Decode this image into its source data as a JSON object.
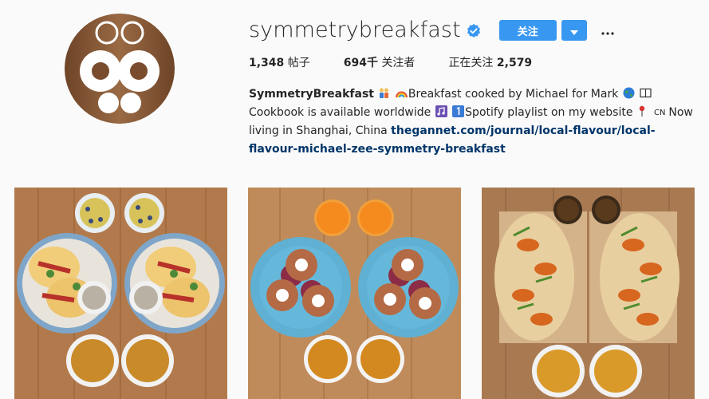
{
  "profile": {
    "username": "symmetrybreakfast",
    "follow_label": "关注",
    "posts_count": "1,348",
    "posts_label": "帖子",
    "followers_count": "694千",
    "followers_label": "关注者",
    "following_label": "正在关注",
    "following_count": "2,579",
    "bio": {
      "full_name": "SymmetryBreakfast",
      "seg1": "Breakfast cooked by Michael for Mark",
      "seg2": "Cookbook is available worldwide",
      "seg3": "Spotify playlist on my website",
      "seg4": "Now living in Shanghai, China",
      "link": "thegannet.com/journal/local-flavour/local-flavour-michael-zee-symmetry-breakfast"
    }
  },
  "icons": {
    "verified": "verified-badge-icon",
    "dropdown": "chevron-down-icon",
    "more": "more-options-icon"
  },
  "colors": {
    "accent": "#3897f0",
    "link": "#003569",
    "background": "#fafafa"
  },
  "posts": [
    {
      "alt": "tacos-with-blueberry-bowls-and-tea"
    },
    {
      "alt": "pastries-with-orange-juice-and-tea"
    },
    {
      "alt": "pumpkin-flatbreads-with-coffee-and-tea"
    }
  ]
}
